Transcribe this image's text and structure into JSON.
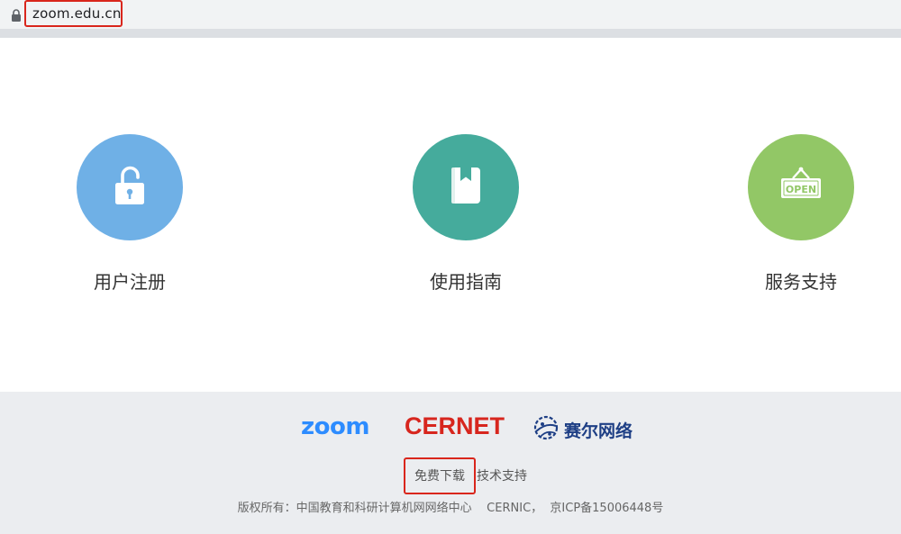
{
  "browser": {
    "url": "zoom.edu.cn"
  },
  "features": [
    {
      "label": "用户注册",
      "icon": "unlock-icon",
      "color": "#6fb0e6"
    },
    {
      "label": "使用指南",
      "icon": "book-icon",
      "color": "#45ab9c"
    },
    {
      "label": "服务支持",
      "icon": "open-sign-icon",
      "color": "#92c766",
      "sign_text": "OPEN"
    }
  ],
  "footer": {
    "logos": {
      "zoom": "zoom",
      "cernet": "CERNET",
      "saier": "赛尔网络"
    },
    "links": {
      "download": "免费下载",
      "support": "技术支持"
    },
    "copyright": "版权所有：中国教育和科研计算机网网络中心    CERNIC，  京ICP备15006448号"
  },
  "colors": {
    "highlight_box": "#d9261c",
    "zoom_blue": "#2d8cff",
    "cernet_red": "#d7261e",
    "saier_navy": "#1e3f85"
  }
}
